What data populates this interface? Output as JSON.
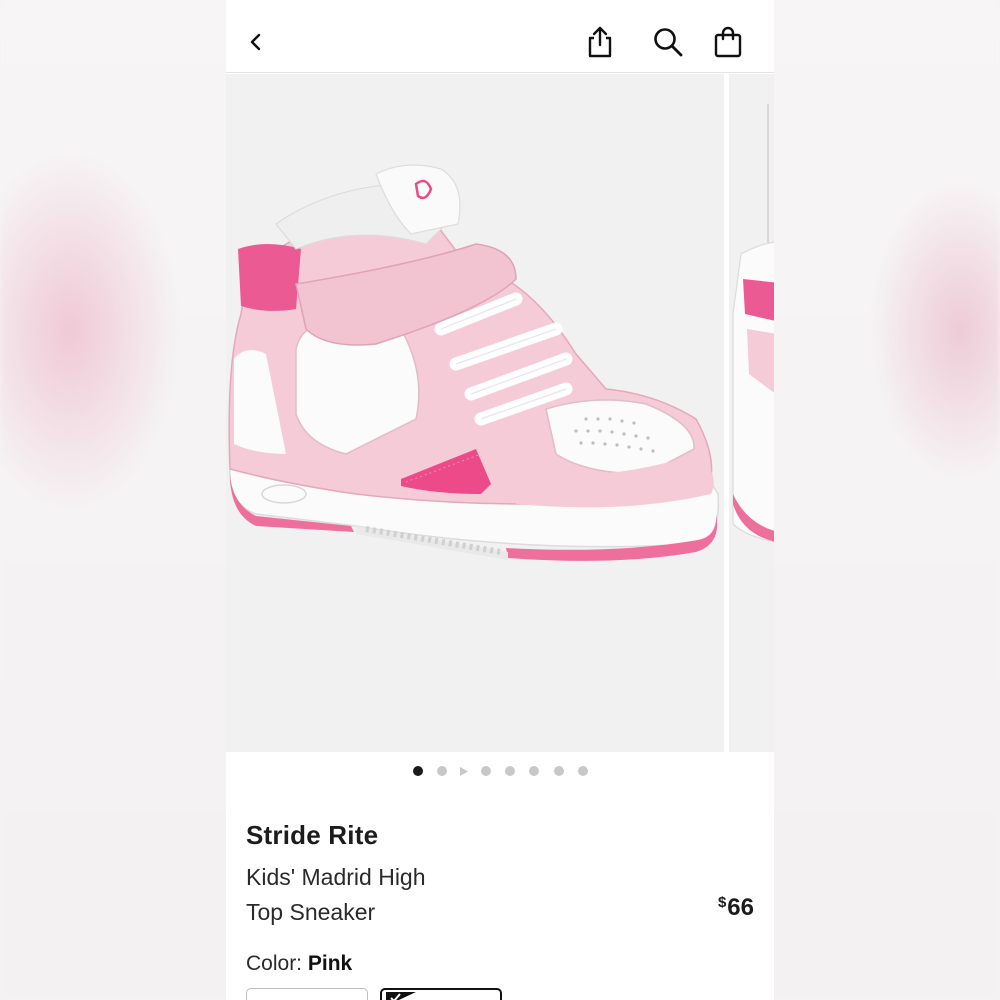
{
  "header": {
    "back_icon": "chevron-left-icon",
    "share_icon": "share-icon",
    "search_icon": "search-icon",
    "bag_icon": "shopping-bag-icon"
  },
  "gallery": {
    "image": "pink and white toddler high-top sneaker with velcro strap",
    "dot_count": 8,
    "active_index": 0
  },
  "product": {
    "brand": "Stride Rite",
    "name_line1": "Kids' Madrid High",
    "name_line2": "Top Sneaker",
    "price_symbol": "$",
    "price_value": "66",
    "color_label": "Color: ",
    "color_value": "Pink"
  },
  "colors": {
    "accent": "#1a1a1a",
    "shoe_pink": "#f2c6d3",
    "shoe_hot_pink": "#ec4a88"
  }
}
